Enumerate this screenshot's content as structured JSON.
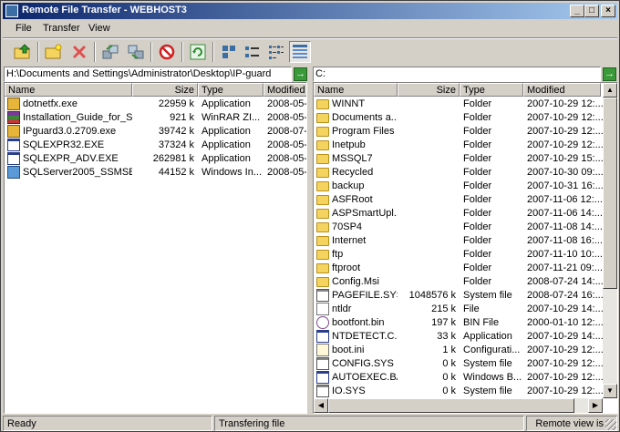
{
  "window": {
    "title": "Remote File Transfer - WEBHOST3"
  },
  "menu": {
    "file": "File",
    "transfer": "Transfer",
    "view": "View"
  },
  "toolbar": {
    "tools": [
      "up-folder-icon",
      "new-folder-icon",
      "delete-icon",
      "upload-icon",
      "download-icon",
      "stop-icon",
      "refresh-icon",
      "large-icons-icon",
      "small-icons-icon",
      "list-view-icon",
      "details-view-icon"
    ]
  },
  "local": {
    "path": "H:\\Documents and Settings\\Administrator\\Desktop\\IP-guard",
    "columns": {
      "name": "Name",
      "size": "Size",
      "type": "Type",
      "modified": "Modified"
    },
    "files": [
      {
        "name": "dotnetfx.exe",
        "size": "22959 k",
        "type": "Application",
        "modified": "2008-05-1",
        "icon": "installer-icon"
      },
      {
        "name": "Installation_Guide_for_S...",
        "size": "921 k",
        "type": "WinRAR ZI...",
        "modified": "2008-05-1",
        "icon": "winrar-icon"
      },
      {
        "name": "IPguard3.0.2709.exe",
        "size": "39742 k",
        "type": "Application",
        "modified": "2008-07-2",
        "icon": "installer-icon"
      },
      {
        "name": "SQLEXPR32.EXE",
        "size": "37324 k",
        "type": "Application",
        "modified": "2008-05-1",
        "icon": "exe-icon"
      },
      {
        "name": "SQLEXPR_ADV.EXE",
        "size": "262981 k",
        "type": "Application",
        "modified": "2008-05-1",
        "icon": "exe-icon"
      },
      {
        "name": "SQLServer2005_SSMSEE...",
        "size": "44152 k",
        "type": "Windows In...",
        "modified": "2008-05-1",
        "icon": "msi-icon"
      }
    ]
  },
  "remote": {
    "path": "C:",
    "columns": {
      "name": "Name",
      "size": "Size",
      "type": "Type",
      "modified": "Modified"
    },
    "files": [
      {
        "name": "WINNT",
        "size": "",
        "type": "Folder",
        "modified": "2007-10-29 12:...",
        "icon": "folder-icon"
      },
      {
        "name": "Documents a...",
        "size": "",
        "type": "Folder",
        "modified": "2007-10-29 12:...",
        "icon": "folder-icon"
      },
      {
        "name": "Program Files",
        "size": "",
        "type": "Folder",
        "modified": "2007-10-29 12:...",
        "icon": "folder-icon"
      },
      {
        "name": "Inetpub",
        "size": "",
        "type": "Folder",
        "modified": "2007-10-29 12:...",
        "icon": "folder-icon"
      },
      {
        "name": "MSSQL7",
        "size": "",
        "type": "Folder",
        "modified": "2007-10-29 15:...",
        "icon": "folder-icon"
      },
      {
        "name": "Recycled",
        "size": "",
        "type": "Folder",
        "modified": "2007-10-30 09:...",
        "icon": "folder-icon"
      },
      {
        "name": "backup",
        "size": "",
        "type": "Folder",
        "modified": "2007-10-31 16:...",
        "icon": "folder-icon"
      },
      {
        "name": "ASFRoot",
        "size": "",
        "type": "Folder",
        "modified": "2007-11-06 12:...",
        "icon": "folder-icon"
      },
      {
        "name": "ASPSmartUpl...",
        "size": "",
        "type": "Folder",
        "modified": "2007-11-06 14:...",
        "icon": "folder-icon"
      },
      {
        "name": "70SP4",
        "size": "",
        "type": "Folder",
        "modified": "2007-11-08 14:...",
        "icon": "folder-icon"
      },
      {
        "name": "Internet",
        "size": "",
        "type": "Folder",
        "modified": "2007-11-08 16:...",
        "icon": "folder-icon"
      },
      {
        "name": "ftp",
        "size": "",
        "type": "Folder",
        "modified": "2007-11-10 10:...",
        "icon": "folder-icon"
      },
      {
        "name": "ftproot",
        "size": "",
        "type": "Folder",
        "modified": "2007-11-21 09:...",
        "icon": "folder-icon"
      },
      {
        "name": "Config.Msi",
        "size": "",
        "type": "Folder",
        "modified": "2008-07-24 14:...",
        "icon": "folder-icon"
      },
      {
        "name": "PAGEFILE.SYS",
        "size": "1048576 k",
        "type": "System file",
        "modified": "2008-07-24 16:...",
        "icon": "system-file-icon"
      },
      {
        "name": "ntldr",
        "size": "215 k",
        "type": "File",
        "modified": "2007-10-29 14:...",
        "icon": "file-icon"
      },
      {
        "name": "bootfont.bin",
        "size": "197 k",
        "type": "BIN File",
        "modified": "2000-01-10 12:...",
        "icon": "bin-file-icon"
      },
      {
        "name": "NTDETECT.C...",
        "size": "33 k",
        "type": "Application",
        "modified": "2007-10-29 14:...",
        "icon": "exe-icon"
      },
      {
        "name": "boot.ini",
        "size": "1 k",
        "type": "Configurati...",
        "modified": "2007-10-29 12:...",
        "icon": "ini-file-icon"
      },
      {
        "name": "CONFIG.SYS",
        "size": "0 k",
        "type": "System file",
        "modified": "2007-10-29 12:...",
        "icon": "system-file-icon"
      },
      {
        "name": "AUTOEXEC.BAT",
        "size": "0 k",
        "type": "Windows B...",
        "modified": "2007-10-29 12:...",
        "icon": "exe-icon"
      },
      {
        "name": "IO.SYS",
        "size": "0 k",
        "type": "System file",
        "modified": "2007-10-29 12:...",
        "icon": "system-file-icon"
      }
    ]
  },
  "status": {
    "left": "Ready",
    "middle": "Transfering file",
    "right": "Remote view is"
  }
}
